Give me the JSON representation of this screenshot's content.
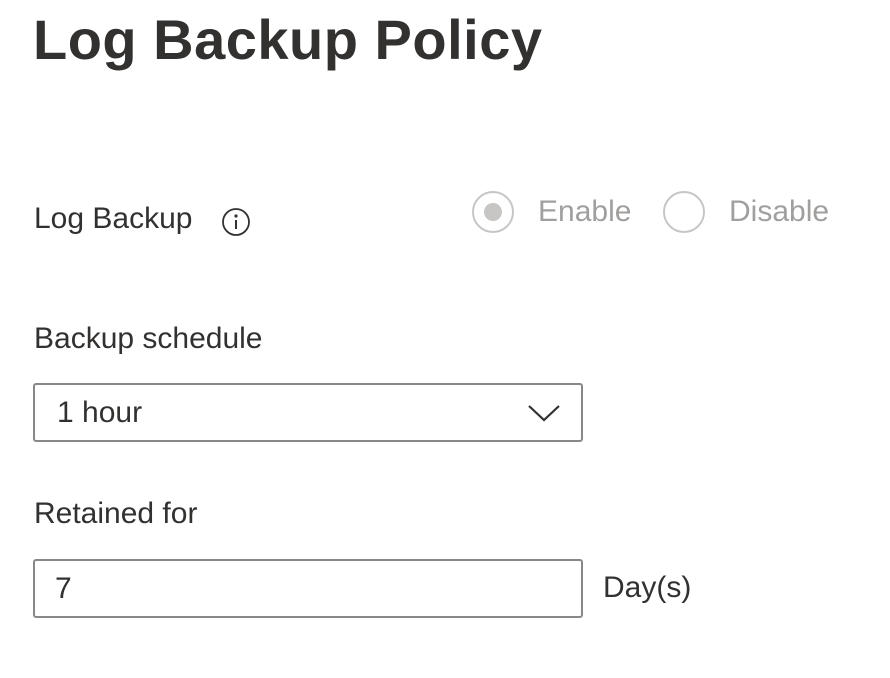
{
  "page": {
    "title": "Log Backup Policy"
  },
  "log_backup": {
    "label": "Log Backup",
    "info_icon": "info-icon",
    "options": [
      {
        "label": "Enable",
        "selected": true,
        "disabled": true
      },
      {
        "label": "Disable",
        "selected": false,
        "disabled": true
      }
    ]
  },
  "backup_schedule": {
    "label": "Backup schedule",
    "selected_value": "1 hour",
    "icon": "chevron-down-icon"
  },
  "retained_for": {
    "label": "Retained for",
    "value": "7",
    "unit": "Day(s)"
  },
  "colors": {
    "text": "#323130",
    "disabled_text": "#a19f9d",
    "disabled_radio": "#c8c6c4",
    "input_border": "#8a8886"
  }
}
